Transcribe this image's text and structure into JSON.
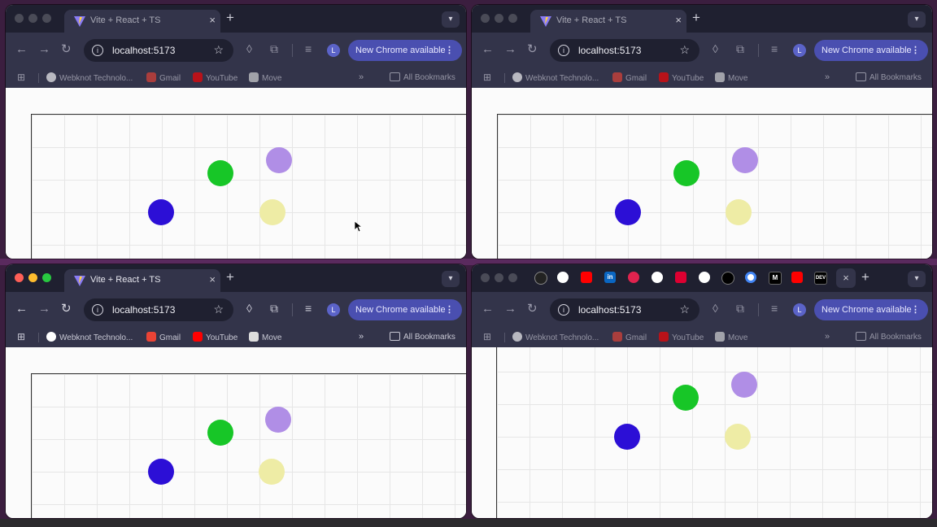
{
  "tab": {
    "title": "Vite + React + TS",
    "close": "×",
    "new": "+",
    "menu": "▾"
  },
  "toolbar": {
    "back": "←",
    "forward": "→",
    "reload": "↻",
    "url": "localhost:5173",
    "star": "☆",
    "avatar": "L",
    "update_label": "New Chrome available",
    "update_more": "⋮"
  },
  "bookmarks": {
    "items": [
      {
        "label": "Webknot Technolo...",
        "icon": "github-icon",
        "color": "#ffffff"
      },
      {
        "label": "Gmail",
        "icon": "gmail-icon",
        "color": "#ea4335"
      },
      {
        "label": "YouTube",
        "icon": "youtube-icon",
        "color": "#ff0000"
      },
      {
        "label": "Move",
        "icon": "move-icon",
        "color": "#dddddd"
      }
    ],
    "more": "»",
    "all": "All Bookmarks"
  },
  "balls": {
    "blue": "#2c0fd6",
    "green": "#17c627",
    "purple": "#b08ee6",
    "yellow": "#eeeca5"
  },
  "pinned_tabs": [
    "openai-icon",
    "github-icon",
    "youtube-icon",
    "linkedin-icon",
    "nest-icon",
    "github-icon",
    "angular-icon",
    "github-icon",
    "nextjs-icon",
    "google-icon",
    "medium-icon",
    "youtube-icon",
    "dev-icon"
  ]
}
